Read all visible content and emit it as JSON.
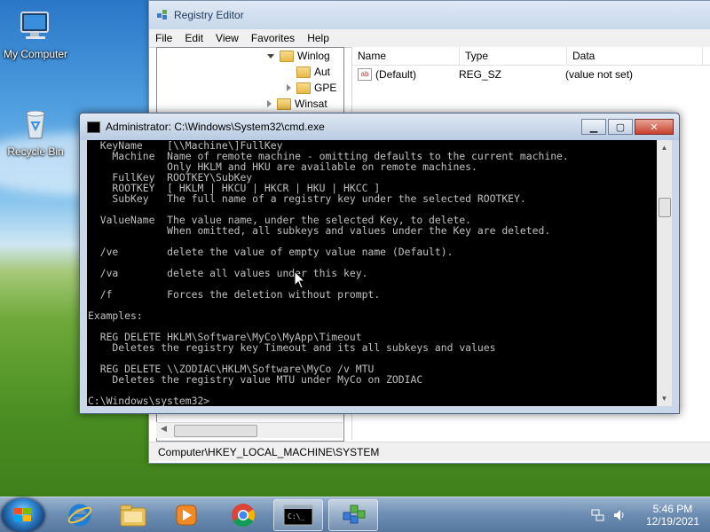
{
  "desktop": {
    "icons": [
      {
        "label": "My Computer",
        "icon": "computer-icon"
      },
      {
        "label": "Recycle Bin",
        "icon": "recycle-bin-icon"
      }
    ]
  },
  "registry_editor": {
    "title": "Registry Editor",
    "menu": [
      "File",
      "Edit",
      "View",
      "Favorites",
      "Help"
    ],
    "tree": [
      {
        "label": "Winlog",
        "expanded": true
      },
      {
        "label": "Aut",
        "expanded": false
      },
      {
        "label": "GPE",
        "expanded": false
      },
      {
        "label": "Winsat",
        "expanded": false
      }
    ],
    "columns": [
      "Name",
      "Type",
      "Data"
    ],
    "rows": [
      {
        "name": "(Default)",
        "type": "REG_SZ",
        "data": "(value not set)"
      }
    ],
    "status": "Computer\\HKEY_LOCAL_MACHINE\\SYSTEM"
  },
  "cmd": {
    "title": "Administrator: C:\\Windows\\System32\\cmd.exe",
    "lines": [
      "  KeyName    [\\\\Machine\\]FullKey",
      "    Machine  Name of remote machine - omitting defaults to the current machine.",
      "             Only HKLM and HKU are available on remote machines.",
      "    FullKey  ROOTKEY\\SubKey",
      "    ROOTKEY  [ HKLM | HKCU | HKCR | HKU | HKCC ]",
      "    SubKey   The full name of a registry key under the selected ROOTKEY.",
      "",
      "  ValueName  The value name, under the selected Key, to delete.",
      "             When omitted, all subkeys and values under the Key are deleted.",
      "",
      "  /ve        delete the value of empty value name (Default).",
      "",
      "  /va        delete all values under this key.",
      "",
      "  /f         Forces the deletion without prompt.",
      "",
      "Examples:",
      "",
      "  REG DELETE HKLM\\Software\\MyCo\\MyApp\\Timeout",
      "    Deletes the registry key Timeout and its all subkeys and values",
      "",
      "  REG DELETE \\\\ZODIAC\\HKLM\\Software\\MyCo /v MTU",
      "    Deletes the registry value MTU under MyCo on ZODIAC",
      "",
      "C:\\Windows\\system32>"
    ]
  },
  "taskbar": {
    "apps": [
      {
        "name": "internet-explorer",
        "active": false
      },
      {
        "name": "file-explorer",
        "active": false
      },
      {
        "name": "media-player",
        "active": false
      },
      {
        "name": "chrome",
        "active": false
      },
      {
        "name": "cmd",
        "active": true
      },
      {
        "name": "registry-editor",
        "active": true
      }
    ],
    "time": "5:46 PM",
    "date": "12/19/2021"
  }
}
